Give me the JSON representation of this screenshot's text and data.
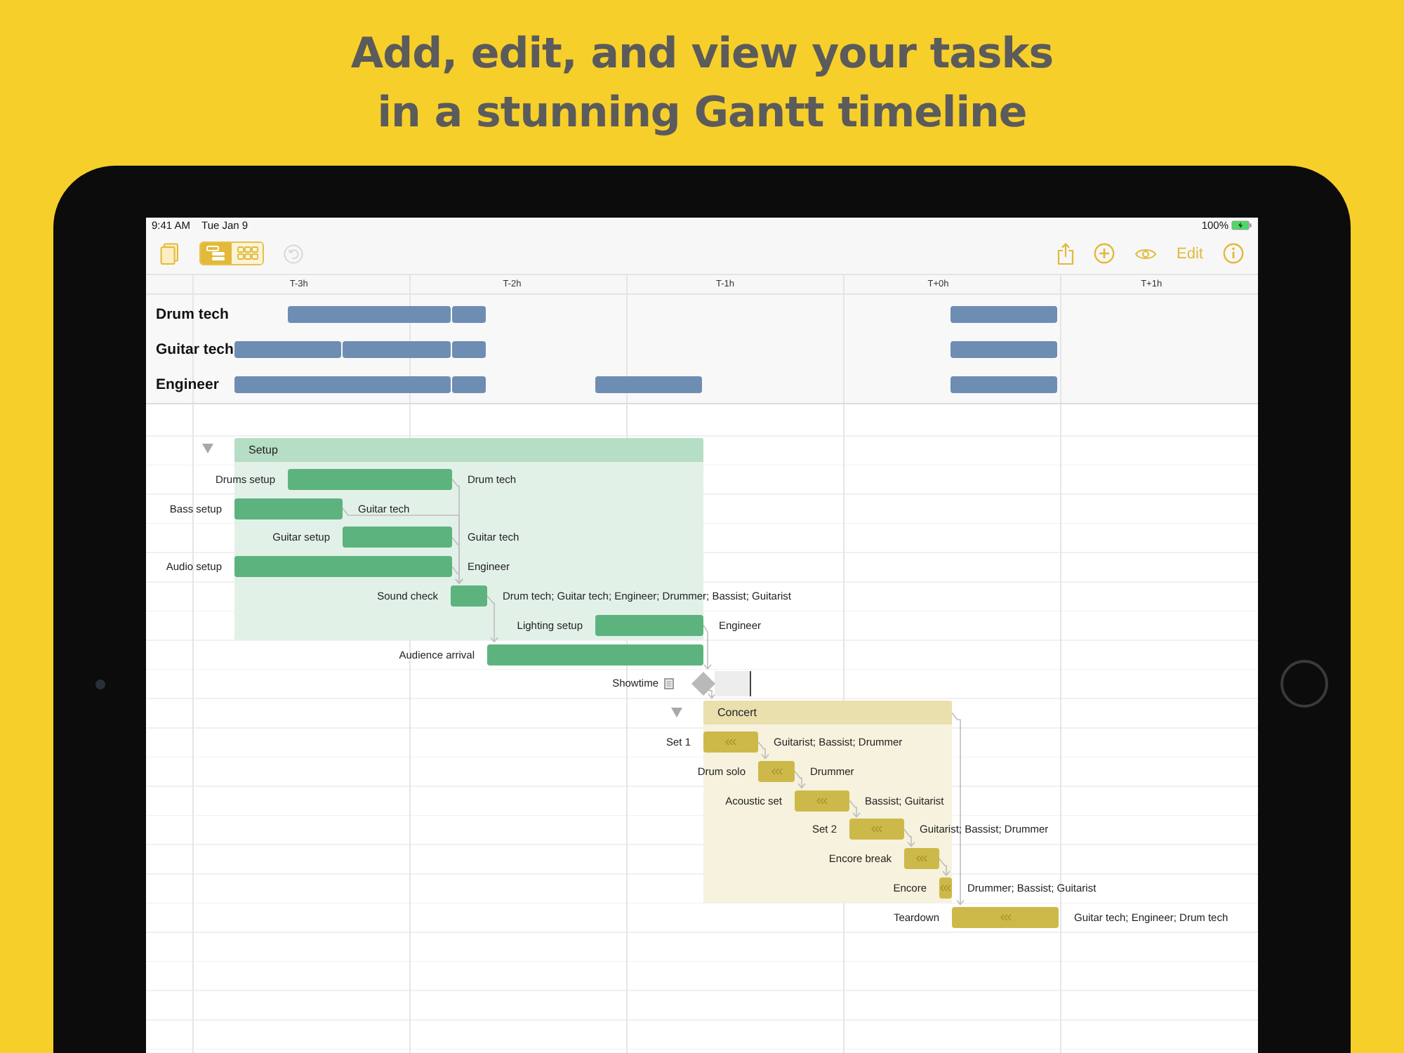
{
  "headline": "Add, edit, and view your tasks\nin a stunning Gantt timeline",
  "status_bar": {
    "time": "9:41 AM",
    "date": "Tue Jan 9",
    "battery": "100%"
  },
  "toolbar": {
    "view_switch": [
      {
        "selected": true
      },
      {
        "selected": false
      }
    ],
    "undo": {
      "disabled": true
    },
    "edit_label": "Edit"
  },
  "timeline": {
    "columns": [
      "T-3h",
      "T-2h",
      "T-1h",
      "T+0h",
      "T+1h"
    ]
  },
  "resources": [
    {
      "name": "Drum tech"
    },
    {
      "name": "Guitar tech"
    },
    {
      "name": "Engineer"
    }
  ],
  "tasks": [
    {
      "name": "Setup",
      "kind": "group",
      "expanded": true,
      "color": "#5db37e",
      "children": [
        {
          "name": "Drums setup",
          "kind": "task",
          "resources": "Drum tech",
          "marker": false
        },
        {
          "name": "Bass setup",
          "kind": "task",
          "resources": "Guitar tech",
          "marker": false
        },
        {
          "name": "Guitar setup",
          "kind": "task",
          "resources": "Guitar tech",
          "marker": false
        },
        {
          "name": "Audio setup",
          "kind": "task",
          "resources": "Engineer",
          "marker": false
        },
        {
          "name": "Sound check",
          "kind": "task",
          "resources": "Drum tech; Guitar tech; Engineer; Drummer; Bassist; Guitarist",
          "marker": false
        },
        {
          "name": "Lighting setup",
          "kind": "task",
          "resources": "Engineer",
          "marker": false
        }
      ]
    },
    {
      "name": "Audience arrival",
      "kind": "task",
      "color": "#5db37e",
      "marker": false
    },
    {
      "name": "Showtime",
      "kind": "milestone",
      "note": true
    },
    {
      "name": "Concert",
      "kind": "group",
      "expanded": true,
      "color": "#cdb94a",
      "children": [
        {
          "name": "Set 1",
          "kind": "task",
          "resources": "Guitarist; Bassist; Drummer",
          "marker": true
        },
        {
          "name": "Drum solo",
          "kind": "task",
          "resources": "Drummer",
          "marker": true
        },
        {
          "name": "Acoustic set",
          "kind": "task",
          "resources": "Bassist; Guitarist",
          "marker": true
        },
        {
          "name": "Set 2",
          "kind": "task",
          "resources": "Guitarist; Bassist; Drummer",
          "marker": true
        },
        {
          "name": "Encore break",
          "kind": "task",
          "marker": true
        },
        {
          "name": "Encore",
          "kind": "task",
          "resources": "Drummer; Bassist; Guitarist",
          "marker": true
        }
      ]
    },
    {
      "name": "Teardown",
      "kind": "task",
      "color": "#cdb94a",
      "resources": "Guitar tech; Engineer; Drum tech",
      "marker": true
    }
  ]
}
